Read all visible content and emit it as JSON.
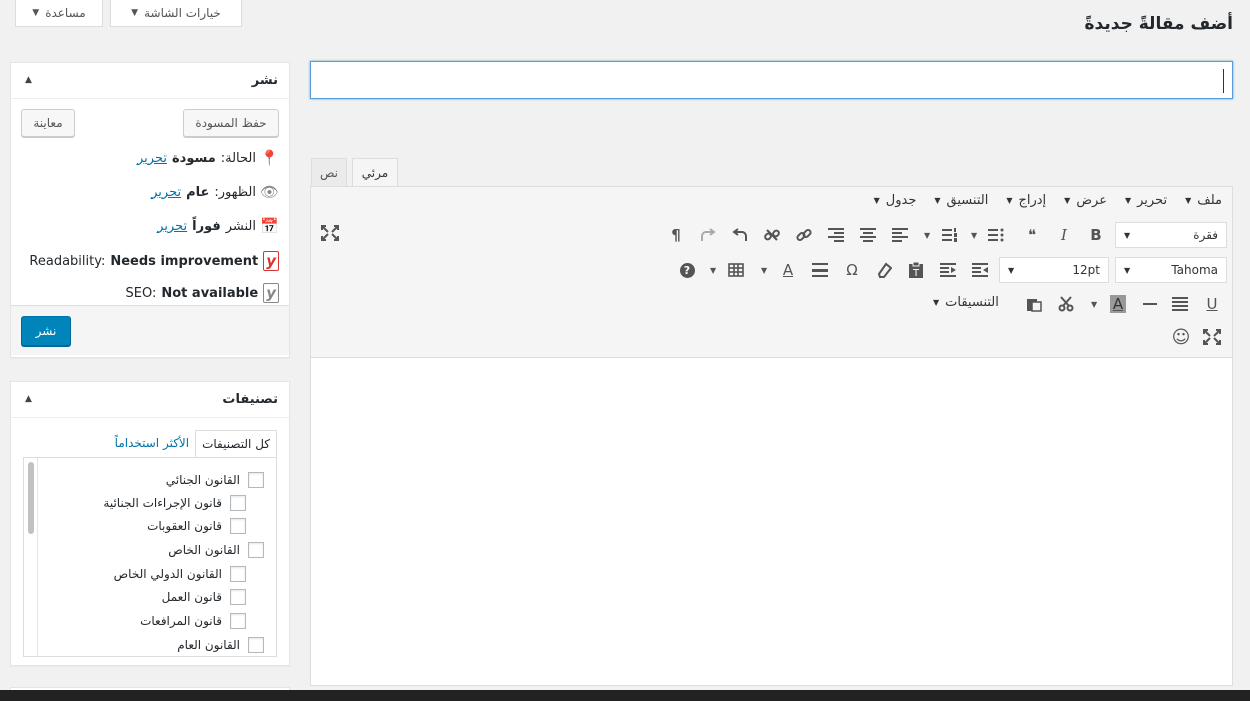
{
  "screen_meta": {
    "screen_options_label": "خيارات الشاشة",
    "help_label": "مساعدة"
  },
  "page_title": "أضف مقالةً جديدةً",
  "title_input": {
    "value": ""
  },
  "editor": {
    "tabs": {
      "visual": "مرئي",
      "text": "نص"
    },
    "menu": [
      "ملف",
      "تحرير",
      "عرض",
      "إدراج",
      "التنسيق",
      "جدول"
    ],
    "format_select": "فقرة",
    "font_family": "Tahoma",
    "font_size": "12pt",
    "formats_label": "التنسيقات",
    "icons": {
      "bold": "B",
      "italic": "I",
      "quote": "❝",
      "paragraph": "¶",
      "omega": "Ω",
      "help": "?",
      "underline": "U",
      "text_color": "A",
      "bg_color": "A",
      "emoji": "☺"
    }
  },
  "publish_box": {
    "title": "نشر",
    "save_draft": "حفظ المسودة",
    "preview": "معاينة",
    "status_label": "الحالة:",
    "status_value": "مسودة",
    "visibility_label": "الظهور:",
    "visibility_value": "عام",
    "schedule_label": "النشر",
    "schedule_value": "فوراً",
    "edit_link": "تحرير",
    "readability_label": "Readability:",
    "readability_value": "Needs improvement",
    "seo_label": "SEO:",
    "seo_value": "Not available",
    "publish_button": "نشر",
    "colors": {
      "readability_icon": "#dc3232",
      "seo_icon": "#888888"
    }
  },
  "categories_box": {
    "title": "تصنيفات",
    "tab_all": "كل التصنيفات",
    "tab_popular": "الأكثر استخداماً",
    "items": [
      "القانون الجنائي",
      "قانون الإجراءات الجنائية",
      "قانون العقوبات",
      "القانون الخاص",
      "القانون الدولي الخاص",
      "قانون العمل",
      "قانون المرافعات",
      "القانون العام"
    ]
  }
}
